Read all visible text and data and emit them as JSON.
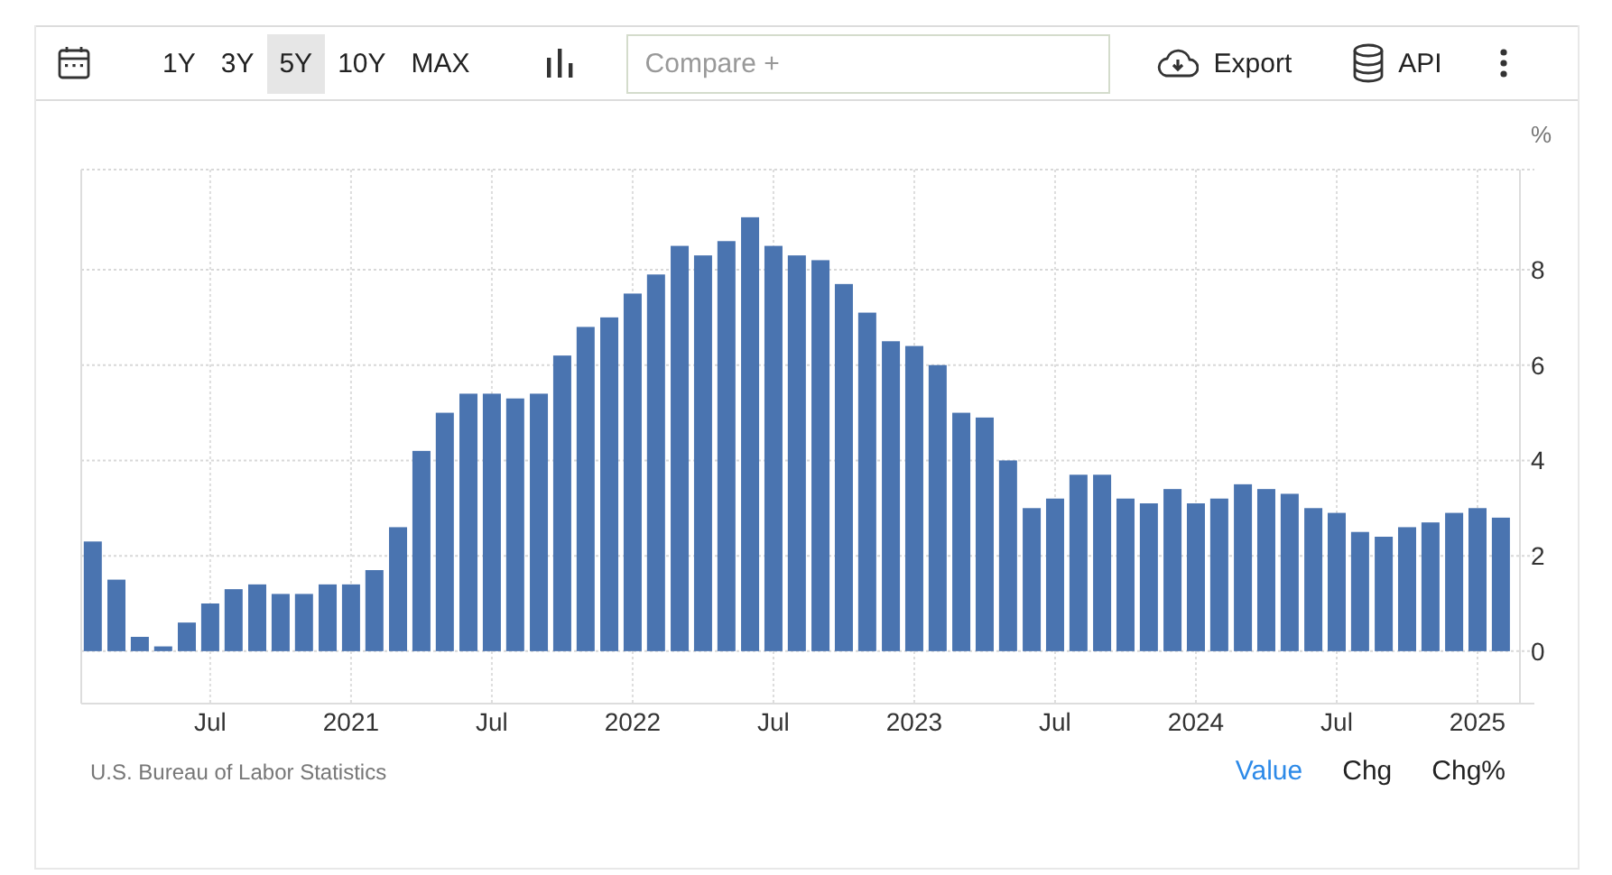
{
  "toolbar": {
    "ranges": [
      {
        "label": "1Y",
        "selected": false
      },
      {
        "label": "3Y",
        "selected": false
      },
      {
        "label": "5Y",
        "selected": true
      },
      {
        "label": "10Y",
        "selected": false
      },
      {
        "label": "MAX",
        "selected": false
      }
    ],
    "compare": {
      "placeholder": "Compare +"
    },
    "export": "Export",
    "api": "API"
  },
  "chart": {
    "unit": "%",
    "chart_data": {
      "type": "bar",
      "x": [
        2020.083,
        2020.167,
        2020.25,
        2020.333,
        2020.417,
        2020.5,
        2020.583,
        2020.667,
        2020.75,
        2020.833,
        2020.917,
        2021,
        2021.083,
        2021.167,
        2021.25,
        2021.333,
        2021.417,
        2021.5,
        2021.583,
        2021.667,
        2021.75,
        2021.833,
        2021.917,
        2022,
        2022.083,
        2022.167,
        2022.25,
        2022.333,
        2022.417,
        2022.5,
        2022.583,
        2022.667,
        2022.75,
        2022.833,
        2022.917,
        2023,
        2023.083,
        2023.167,
        2023.25,
        2023.333,
        2023.417,
        2023.5,
        2023.583,
        2023.667,
        2023.75,
        2023.833,
        2023.917,
        2024,
        2024.083,
        2024.167,
        2024.25,
        2024.333,
        2024.417,
        2024.5,
        2024.583,
        2024.667,
        2024.75,
        2024.833,
        2024.917,
        2025,
        2025.083
      ],
      "grid": true,
      "xlim": [
        2020.042,
        2025.125
      ],
      "series": [
        {
          "color": "#4a74b0",
          "values": [
            2.3,
            1.5,
            0.3,
            0.1,
            0.6,
            1.0,
            1.3,
            1.4,
            1.2,
            1.2,
            1.4,
            1.4,
            1.7,
            2.6,
            4.2,
            5.0,
            5.4,
            5.4,
            5.3,
            5.4,
            6.2,
            6.8,
            7.0,
            7.5,
            7.9,
            8.5,
            8.3,
            8.6,
            9.1,
            8.5,
            8.3,
            8.2,
            7.7,
            7.1,
            6.5,
            6.4,
            6.0,
            5.0,
            4.9,
            4.0,
            3.0,
            3.2,
            3.7,
            3.7,
            3.2,
            3.1,
            3.4,
            3.1,
            3.2,
            3.5,
            3.4,
            3.3,
            3.0,
            2.9,
            2.5,
            2.4,
            2.6,
            2.7,
            2.9,
            3.0,
            2.8
          ]
        }
      ],
      "ylim": [
        -1.1,
        10.1
      ],
      "yticks": [
        0,
        2,
        4,
        6,
        8
      ],
      "xticks": [
        {
          "value": 2020.5,
          "label": "Jul"
        },
        {
          "value": 2021,
          "label": "2021"
        },
        {
          "value": 2021.5,
          "label": "Jul"
        },
        {
          "value": 2022,
          "label": "2022"
        },
        {
          "value": 2022.5,
          "label": "Jul"
        },
        {
          "value": 2023,
          "label": "2023"
        },
        {
          "value": 2023.5,
          "label": "Jul"
        },
        {
          "value": 2024,
          "label": "2024"
        },
        {
          "value": 2024.5,
          "label": "Jul"
        },
        {
          "value": 2025,
          "label": "2025"
        }
      ]
    }
  },
  "footer": {
    "source": "U.S. Bureau of Labor Statistics",
    "modes": [
      {
        "label": "Value",
        "selected": true
      },
      {
        "label": "Chg",
        "selected": false
      },
      {
        "label": "Chg%",
        "selected": false
      }
    ]
  }
}
